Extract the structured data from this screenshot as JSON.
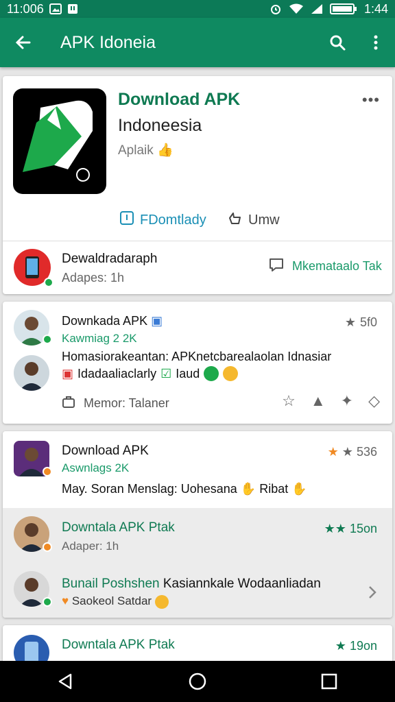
{
  "status_bar": {
    "time_left": "11:006",
    "time_right": "1:44",
    "icons": [
      "image-icon",
      "notification-icon",
      "alarm-icon",
      "wifi-icon",
      "signal-icon",
      "battery-icon"
    ]
  },
  "app_bar": {
    "title": "APK Idoneia",
    "icons": [
      "back-arrow-icon",
      "search-icon",
      "more-vert-icon"
    ]
  },
  "app_card": {
    "name": "Download APK",
    "subtitle": "Indoneesia",
    "category": "Aplaik",
    "more": "•••",
    "primary_action": "FDomtlady",
    "secondary_action": "Umw",
    "row_title": "Dewaldradaraph",
    "row_subtitle": "Adapes: 1h",
    "row_action": "Mkemataalo Tak"
  },
  "post_card": {
    "title": "Downkada APK",
    "meta": "Kawmiag 2 2K",
    "line1": "Homasiorakeantan: APKnetcbarealaolan Idnasiar",
    "line2": "Idadaaliaclarly",
    "line2_tag": "Iaud",
    "rating": "5f0",
    "footer": "Memor: Talaner"
  },
  "list_card": {
    "title": "Download APK",
    "meta": "Aswnlags 2K",
    "line": "May. Soran Menslag: Uohesana",
    "line_tag": "Ribat",
    "rating": "536",
    "items": [
      {
        "title": "Downtala APK Ptak",
        "subtitle": "Adaper: 1h",
        "rating": "15on"
      },
      {
        "title_green": "Bunail Poshshen",
        "title_rest": " Kasiannkale Wodaanliadan",
        "subtitle": "Saokeol Satdar"
      }
    ]
  },
  "bottom_card": {
    "title": "Downtala APK Ptak",
    "rating": "19on"
  },
  "colors": {
    "primary": "#0f8a61",
    "status_bar": "#0c7a57",
    "accent_green": "#0f7a52",
    "link_blue": "#1a8fb5"
  }
}
